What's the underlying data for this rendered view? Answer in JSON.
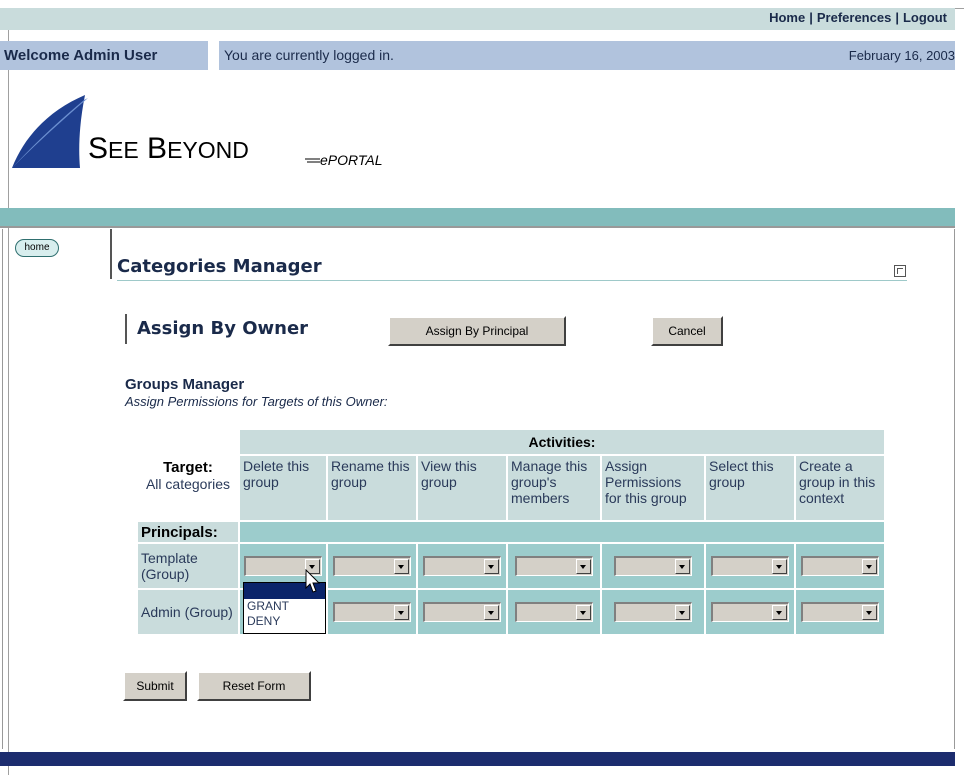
{
  "topnav": {
    "home": "Home",
    "preferences": "Preferences",
    "logout": "Logout",
    "separator": "|"
  },
  "status": {
    "welcome": "Welcome Admin User",
    "message": "You are currently logged in.",
    "date": "February 16, 2003"
  },
  "logo": {
    "brand": "SeeBeyond",
    "product": "ePortal"
  },
  "home_button": "home",
  "page": {
    "title": "Categories Manager",
    "section": "Assign By Owner"
  },
  "buttons": {
    "assign_by_principal": "Assign By Principal",
    "cancel": "Cancel",
    "submit": "Submit",
    "reset": "Reset Form"
  },
  "groups": {
    "title": "Groups Manager",
    "subtitle": "Assign Permissions for Targets of this Owner:"
  },
  "table": {
    "target_label": "Target:",
    "target_value": "All categories",
    "activities_label": "Activities:",
    "principals_label": "Principals:",
    "columns": [
      "Delete this group",
      "Rename this group",
      "View this group",
      "Manage this group's members",
      "Assign Permissions for this group",
      "Select this group",
      "Create a group in this context"
    ],
    "rows": [
      "Template (Group)",
      "Admin (Group)"
    ]
  },
  "dropdown_options": [
    "GRANT",
    "DENY"
  ],
  "colors": {
    "header_teal": "#c9dcdc",
    "cell_teal": "#9ccccc",
    "bar_blue": "#b1c3dd",
    "navy": "#1c2c6e"
  }
}
